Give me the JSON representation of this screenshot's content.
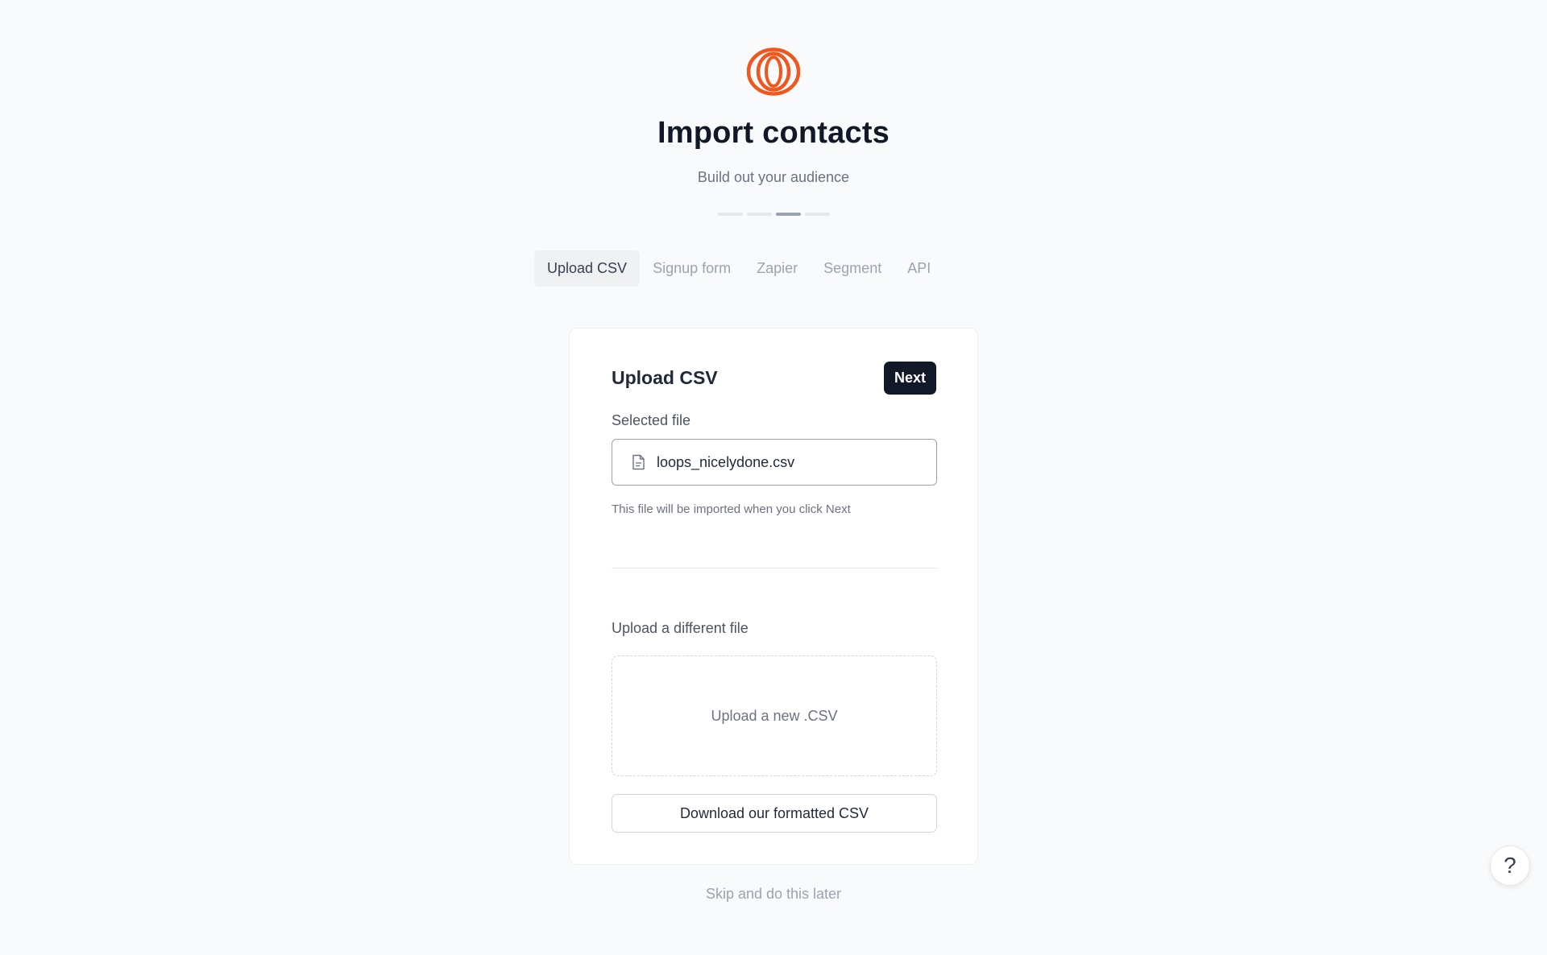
{
  "brand": {
    "logo_icon": "loops-logo-icon",
    "accent_color": "#f0561d"
  },
  "header": {
    "title": "Import contacts",
    "subtitle": "Build out your audience"
  },
  "progress": {
    "total_steps": 4,
    "current_step": 3
  },
  "tabs": [
    {
      "label": "Upload CSV",
      "active": true
    },
    {
      "label": "Signup form",
      "active": false
    },
    {
      "label": "Zapier",
      "active": false
    },
    {
      "label": "Segment",
      "active": false
    },
    {
      "label": "API",
      "active": false
    }
  ],
  "card": {
    "title": "Upload CSV",
    "next_label": "Next",
    "selected_file_label": "Selected file",
    "file_icon": "document-icon",
    "file_name": "loops_nicelydone.csv",
    "hint": "This file will be imported when you click Next",
    "upload_label": "Upload a different file",
    "dropzone_text": "Upload a new .CSV",
    "download_label": "Download our formatted CSV"
  },
  "skip_label": "Skip and do this later",
  "help": {
    "icon": "help-icon",
    "label": "?"
  }
}
